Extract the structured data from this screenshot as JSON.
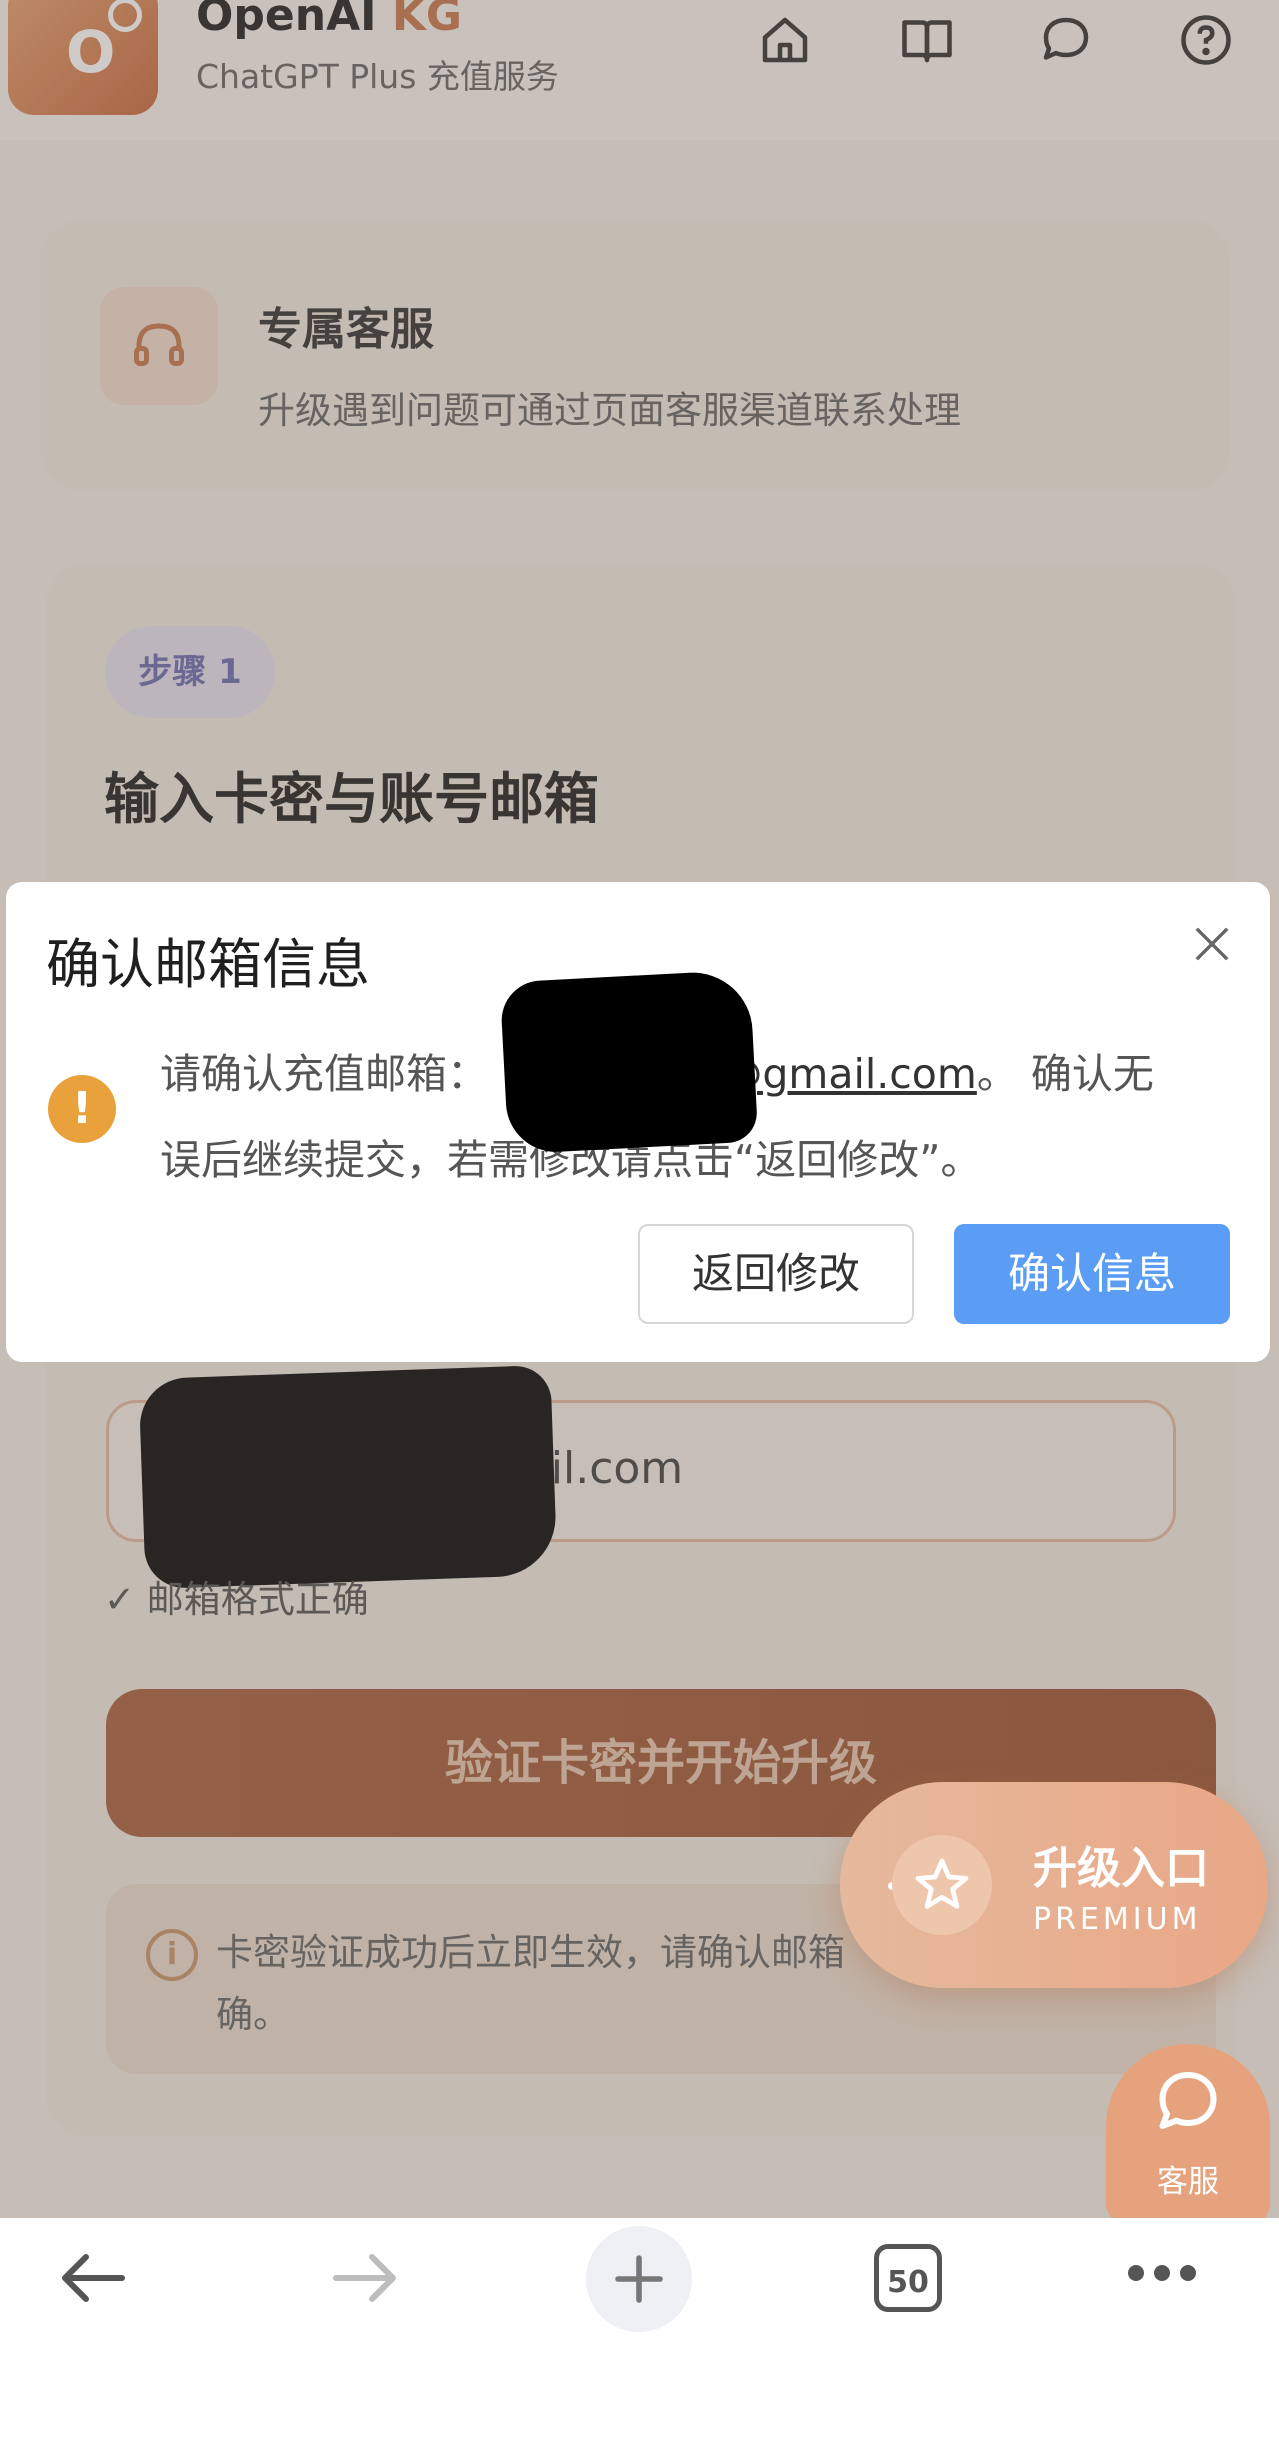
{
  "header": {
    "logo_letter": "O",
    "brand_main": "OpenAI",
    "brand_accent": "KG",
    "subtitle": "ChatGPT Plus 充值服务",
    "nav_icons": [
      "home-icon",
      "book-icon",
      "chat-icon",
      "help-icon"
    ]
  },
  "support_card": {
    "title": "专属客服",
    "description": "升级遇到问题可通过页面客服渠道联系处理"
  },
  "main_card": {
    "step_badge": "步骤 1",
    "title": "输入卡密与账号邮箱",
    "email_value": "gmail.com",
    "valid_message": "✓ 邮箱格式正确",
    "verify_button": "验证卡密并开始升级",
    "notice_text": "卡密验证成功后立即生效，请确认邮箱确。"
  },
  "modal": {
    "title": "确认邮箱信息",
    "message_prefix": "请确认充值邮箱：",
    "message_email": "s@gmail.com",
    "message_suffix": "。 确认无",
    "message_line2": "误后继续提交，若需修改请点击“返回修改”。",
    "back_button": "返回修改",
    "confirm_button": "确认信息"
  },
  "floating": {
    "premium_title": "升级入口",
    "premium_sub": "PREMIUM",
    "service_label": "客服"
  },
  "browser_bar": {
    "tab_count": "50"
  },
  "colors": {
    "accent": "#c77a4d",
    "primary_blue": "#5b9cf4",
    "warning": "#e9a23b"
  }
}
